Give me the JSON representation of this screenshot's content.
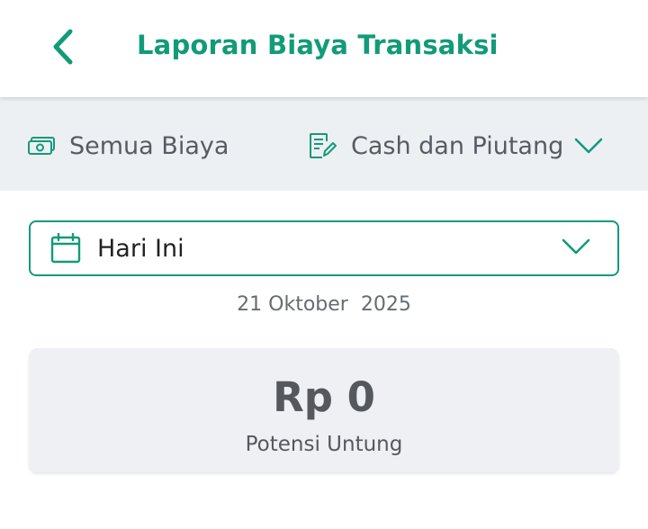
{
  "header": {
    "title": "Laporan Biaya Transaksi",
    "back_icon": "chevron-left-icon"
  },
  "filters": {
    "cost_filter": {
      "label": "Semua Biaya",
      "icon": "money-icon"
    },
    "payment_filter": {
      "label": "Cash dan Piutang",
      "icon": "edit-document-icon",
      "dropdown_icon": "chevron-down-icon"
    }
  },
  "date_selector": {
    "label": "Hari Ini",
    "icon": "calendar-icon",
    "dropdown_icon": "chevron-down-icon"
  },
  "date_display": "21 Oktober  2025",
  "summary": {
    "amount": "Rp 0",
    "label": "Potensi Untung"
  },
  "colors": {
    "accent": "#129b78",
    "filter_bar_bg": "#edf0f3",
    "card_bg": "#eef0f3",
    "muted_text": "#55595d"
  }
}
